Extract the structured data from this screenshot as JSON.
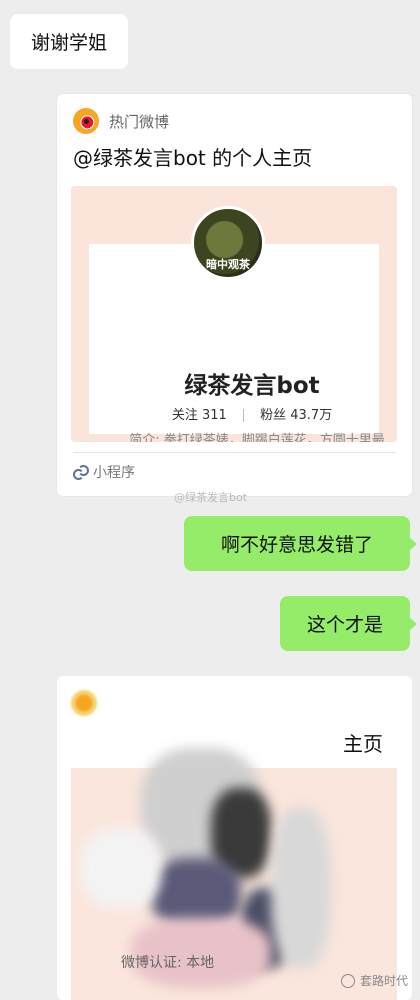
{
  "messages": {
    "incoming_1": "谢谢学姐",
    "outgoing_1": "啊不好意思发错了",
    "outgoing_2": "这个才是"
  },
  "card": {
    "source": "热门微博",
    "title": "@绿茶发言bot 的个人主页",
    "avatar_caption": "暗中观茶",
    "profile_name": "绿茶发言bot",
    "following_label": "关注",
    "following_count": "311",
    "followers_label": "粉丝",
    "followers_count": "43.7万",
    "bio": "简介: 拳打绿茶婊，脚踢白莲花，方圆十里最能吹的博主。",
    "footer": "小程序"
  },
  "watermark_mid": "@绿茶发言bot",
  "blurred_card": {
    "title_tail": "主页",
    "bottom_text": "微博认证: 本地"
  },
  "watermark_bottom": "套路时代",
  "colors": {
    "chat_bg": "#ededed",
    "outgoing_bubble": "#95ec69",
    "incoming_bubble": "#ffffff",
    "preview_bg": "#fbe4da"
  }
}
